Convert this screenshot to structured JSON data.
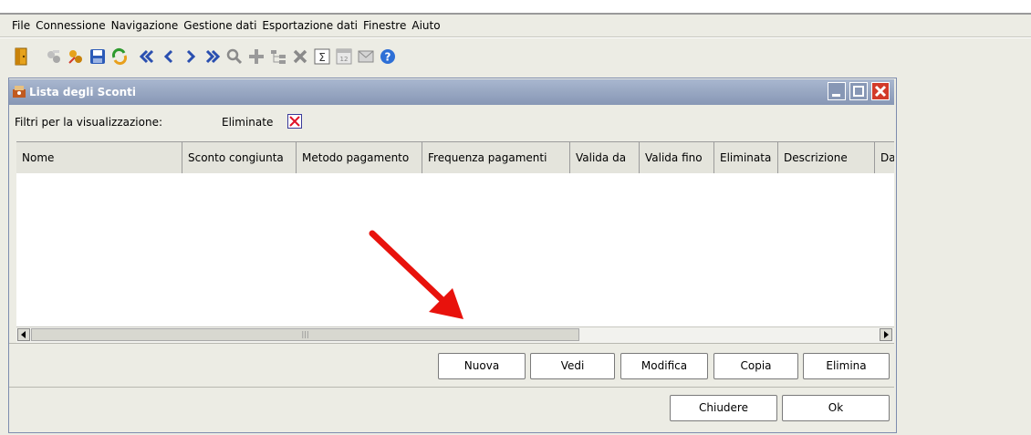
{
  "menu": [
    "File",
    "Connessione",
    "Navigazione",
    "Gestione dati",
    "Esportazione dati",
    "Finestre",
    "Aiuto"
  ],
  "toolbar_icons": [
    "exit-door-icon",
    "connect-icon",
    "disconnect-icon",
    "save-disk-icon",
    "refresh-icon",
    "first-record-icon",
    "previous-record-icon",
    "next-record-icon",
    "last-record-icon",
    "search-icon",
    "add-icon",
    "tree-icon",
    "delete-icon",
    "sum-icon",
    "calendar-icon",
    "envelope-icon",
    "help-icon"
  ],
  "window": {
    "title": "Lista degli Sconti"
  },
  "filters": {
    "label": "Filtri per la visualizzazione:",
    "eliminate_label": "Eliminate"
  },
  "table": {
    "columns": [
      "Nome",
      "Sconto congiunta",
      "Metodo pagamento",
      "Frequenza pagamenti",
      "Valida da",
      "Valida fino",
      "Eliminata",
      "Descrizione",
      "Da"
    ],
    "rows": []
  },
  "buttons": {
    "nuova": "Nuova",
    "vedi": "Vedi",
    "modifica": "Modifica",
    "copia": "Copia",
    "elimina": "Elimina",
    "chiudere": "Chiudere",
    "ok": "Ok"
  },
  "colors": {
    "title_gradient_top": "#a9b7cf",
    "title_gradient_bottom": "#8797b5",
    "close_red": "#d23a2a",
    "arrow_red": "#e8120c",
    "panel_bg": "#ecece4"
  }
}
